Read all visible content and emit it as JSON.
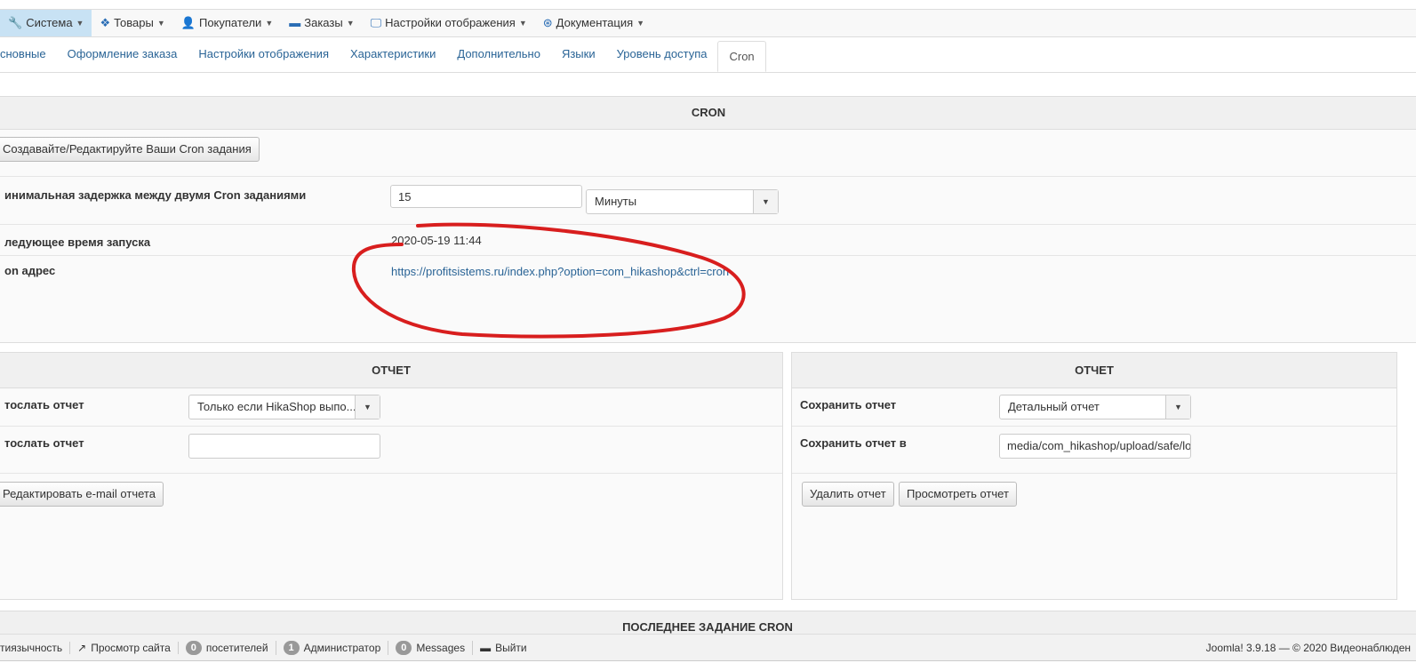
{
  "nav": [
    {
      "label": "Система",
      "icon": "wrench-icon",
      "glyph": "🔧"
    },
    {
      "label": "Товары",
      "icon": "cubes-icon",
      "glyph": "❖"
    },
    {
      "label": "Покупатели",
      "icon": "user-icon",
      "glyph": "👤"
    },
    {
      "label": "Заказы",
      "icon": "credit-card-icon",
      "glyph": "▬"
    },
    {
      "label": "Настройки отображения",
      "icon": "monitor-icon",
      "glyph": "🖵"
    },
    {
      "label": "Документация",
      "icon": "lifebuoy-icon",
      "glyph": "⊛"
    }
  ],
  "tabs": [
    "сновные",
    "Оформление заказа",
    "Настройки отображения",
    "Характеристики",
    "Дополнительно",
    "Языки",
    "Уровень доступа",
    "Cron"
  ],
  "cron": {
    "title": "CRON",
    "edit_button": "Создавайте/Редактируйте Ваши Cron задания",
    "delay_label": "инимальная задержка между двумя Cron заданиями",
    "delay_value": "15",
    "delay_unit": "Минуты",
    "next_label": "ледующее время запуска",
    "next_value": "2020-05-19 11:44",
    "url_label": "on адрес",
    "url": "https://profitsistems.ru/index.php?option=com_hikashop&ctrl=cron"
  },
  "report_left": {
    "title": "ОТЧЕТ",
    "send_label": "тослать отчет",
    "send_value": "Только если HikaShop выпо...",
    "send_to_label": "тослать отчет",
    "send_to_value": "",
    "edit_email_button": "Редактировать e-mail отчета"
  },
  "report_right": {
    "title": "ОТЧЕТ",
    "save_label": "Сохранить отчет",
    "save_value": "Детальный отчет",
    "save_to_label": "Сохранить отчет в",
    "save_to_value": "media/com_hikashop/upload/safe/lo",
    "delete_button": "Удалить отчет",
    "view_button": "Просмотреть отчет"
  },
  "last_cron_title": "ПОСЛЕДНЕЕ ЗАДАНИЕ CRON",
  "footer": {
    "multilang": "тиязычность",
    "view_site": "Просмотр сайта",
    "visitors_count": "0",
    "visitors": "посетителей",
    "admins_count": "1",
    "admins": "Администратор",
    "messages_count": "0",
    "messages": "Messages",
    "logout": "Выйти",
    "version": "Joomla! 3.9.18 — © 2020 Видеонаблюден"
  },
  "annotation_color": "#d81e1e"
}
